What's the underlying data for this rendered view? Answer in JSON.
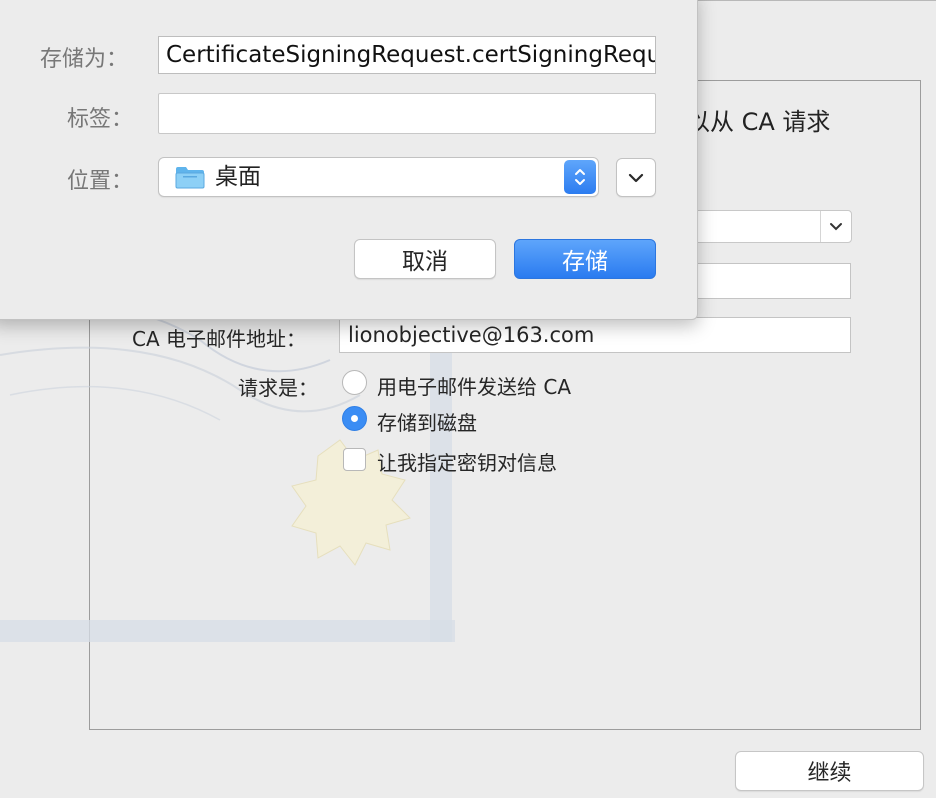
{
  "assistant": {
    "heading_fragment": "以从 CA 请求",
    "email_label": "CA 电子邮件地址：",
    "email_value": "lionobjective@163.com",
    "request_label": "请求是：",
    "option_email": "用电子邮件发送给 CA",
    "option_save": "存储到磁盘",
    "option_save_selected": true,
    "checkbox_label": "让我指定密钥对信息",
    "checkbox_checked": false,
    "continue_label": "继续"
  },
  "save_sheet": {
    "save_as_label": "存储为：",
    "save_as_value": "CertificateSigningRequest.certSigningRequest",
    "tags_label": "标签：",
    "tags_value": "",
    "where_label": "位置：",
    "where_value": "桌面",
    "cancel_label": "取消",
    "save_label": "存储"
  },
  "colors": {
    "accent": "#3b8df4",
    "window_bg": "#ececec"
  },
  "icons": {
    "where": "folder-icon",
    "stepper": "up-down-chevron-icon",
    "expand": "chevron-down-icon"
  }
}
